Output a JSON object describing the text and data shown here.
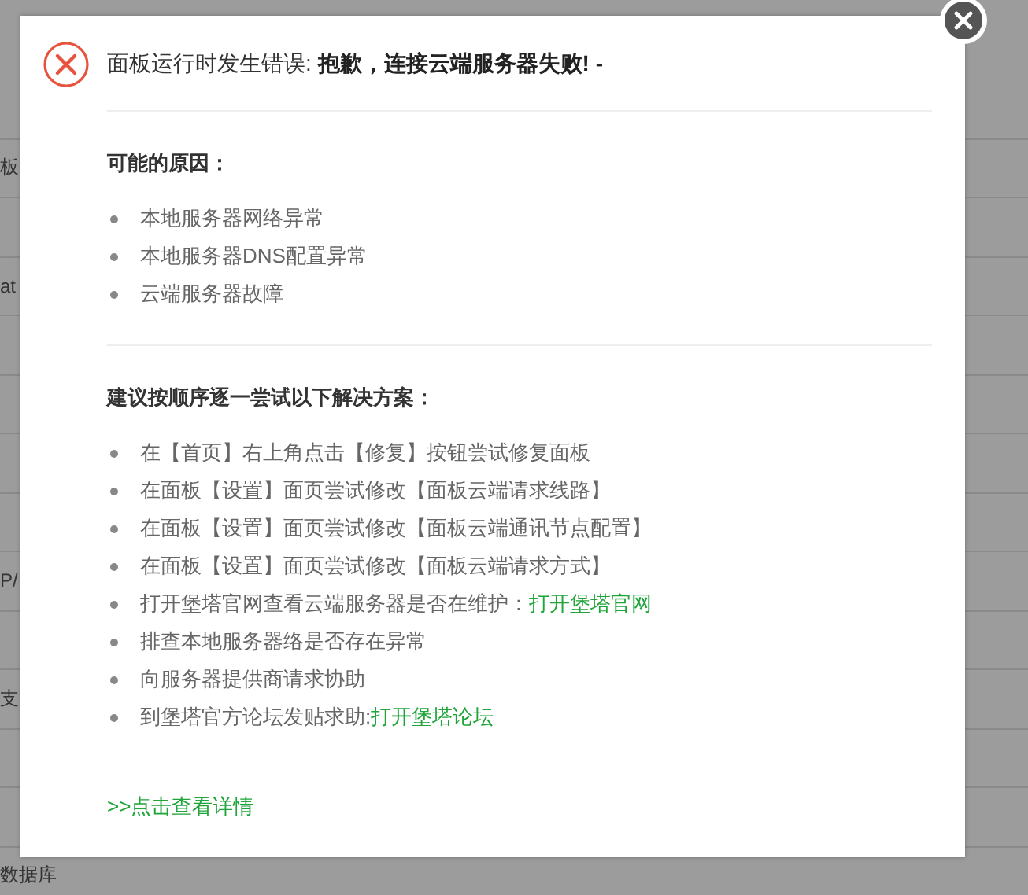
{
  "backdrop_rows": [
    {
      "text": null
    },
    {
      "text": "板"
    },
    {
      "text": null
    },
    {
      "text": "at"
    },
    {
      "text": null
    },
    {
      "text": null
    },
    {
      "text": null
    },
    {
      "text": null
    },
    {
      "text": "P/"
    },
    {
      "text": null
    },
    {
      "text": "支"
    },
    {
      "text": null
    },
    {
      "text": null
    },
    {
      "text": "数据库"
    }
  ],
  "dialog": {
    "title": "面板运行时发生错误: **抱歉，连接云端服务器失败! -**",
    "causes": {
      "heading": "可能的原因：",
      "items": [
        "本地服务器网络异常",
        "本地服务器DNS配置异常",
        "云端服务器故障"
      ]
    },
    "solutions": {
      "heading": "建议按顺序逐一尝试以下解决方案：",
      "items": [
        {
          "text": "在【首页】右上角点击【修复】按钮尝试修复面板"
        },
        {
          "text": "在面板【设置】面页尝试修改【面板云端请求线路】"
        },
        {
          "text": "在面板【设置】面页尝试修改【面板云端通讯节点配置】"
        },
        {
          "text": "在面板【设置】面页尝试修改【面板云端请求方式】"
        },
        {
          "text": "打开堡塔官网查看云端服务器是否在维护：",
          "link": "打开堡塔官网"
        },
        {
          "text": "排查本地服务器络是否存在异常"
        },
        {
          "text": "向服务器提供商请求协助"
        },
        {
          "text": "到堡塔官方论坛发贴求助: ",
          "link": "打开堡塔论坛"
        }
      ]
    },
    "details_link": ">>点击查看详情"
  }
}
